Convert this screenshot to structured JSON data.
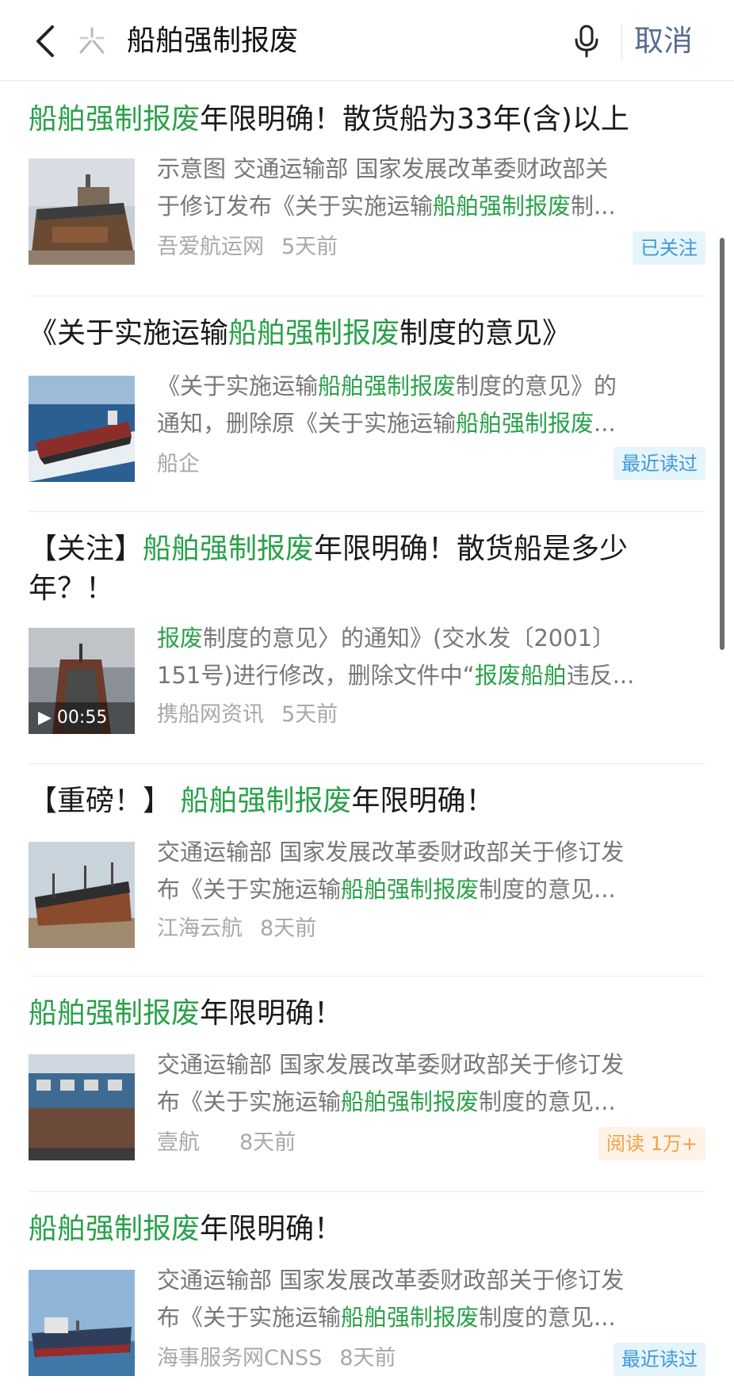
{
  "header": {
    "query": "船舶强制报废",
    "cancel_label": "取消",
    "back_icon": "chevron-left-icon",
    "mic_icon": "microphone-icon",
    "logo_icon": "wechat-search-logo-icon"
  },
  "colors": {
    "highlight": "#2aa14a",
    "link": "#576b95",
    "badge_blue": "#3b9ad6",
    "badge_orange": "#f0a14a"
  },
  "results": [
    {
      "title_parts": [
        "船舶强制报废",
        "年限明确！散货船为33年(含)以上"
      ],
      "snippet_line1": [
        "示意图 交通运输部 国家发展改革委财政部关"
      ],
      "snippet_line2": [
        "于修订发布《关于实施运输",
        "船舶强制报废",
        "制..."
      ],
      "source": "吾爱航运网",
      "time": "5天前",
      "badge": "已关注"
    },
    {
      "title_parts": [
        "《关于实施运输",
        "船舶强制报废",
        "制度的意见》"
      ],
      "snippet_line1": [
        "《关于实施运输",
        "船舶强制报废",
        "制度的意见》的"
      ],
      "snippet_line2": [
        "通知，删除原《关于实施运输",
        "船舶强制报废",
        "..."
      ],
      "source": "船企",
      "time": "",
      "badge": "最近读过"
    },
    {
      "title_parts": [
        "【关注】",
        "船舶强制报废",
        "年限明确！散货船是多少年？！"
      ],
      "snippet_line1": [
        "报废",
        "制度的意见〉的通知》(交水发〔2001〕"
      ],
      "snippet_line2": [
        "151号)进行修改，删除文件中“",
        "报废船舶",
        "违反..."
      ],
      "source": "携船网资讯",
      "time": "5天前",
      "badge": "",
      "video_duration": "00:55"
    },
    {
      "title_parts": [
        "【重磅！】 ",
        "船舶强制报废",
        "年限明确！"
      ],
      "snippet_line1": [
        "交通运输部 国家发展改革委财政部关于修订发"
      ],
      "snippet_line2": [
        "布《关于实施运输",
        "船舶强制报废",
        "制度的意见..."
      ],
      "source": "江海云航",
      "time": "8天前",
      "badge": ""
    },
    {
      "title_parts": [
        "船舶强制报废",
        "年限明确！"
      ],
      "snippet_line1": [
        "交通运输部 国家发展改革委财政部关于修订发"
      ],
      "snippet_line2": [
        "布《关于实施运输",
        "船舶强制报废",
        "制度的意见..."
      ],
      "source": "壹航",
      "time": "8天前",
      "badge": "阅读 1万+"
    },
    {
      "title_parts": [
        "船舶强制报废",
        "年限明确！"
      ],
      "snippet_line1": [
        "交通运输部 国家发展改革委财政部关于修订发"
      ],
      "snippet_line2": [
        "布《关于实施运输",
        "船舶强制报废",
        "制度的意见..."
      ],
      "source": "海事服务网CNSS",
      "time": "8天前",
      "badge": "最近读过"
    }
  ]
}
